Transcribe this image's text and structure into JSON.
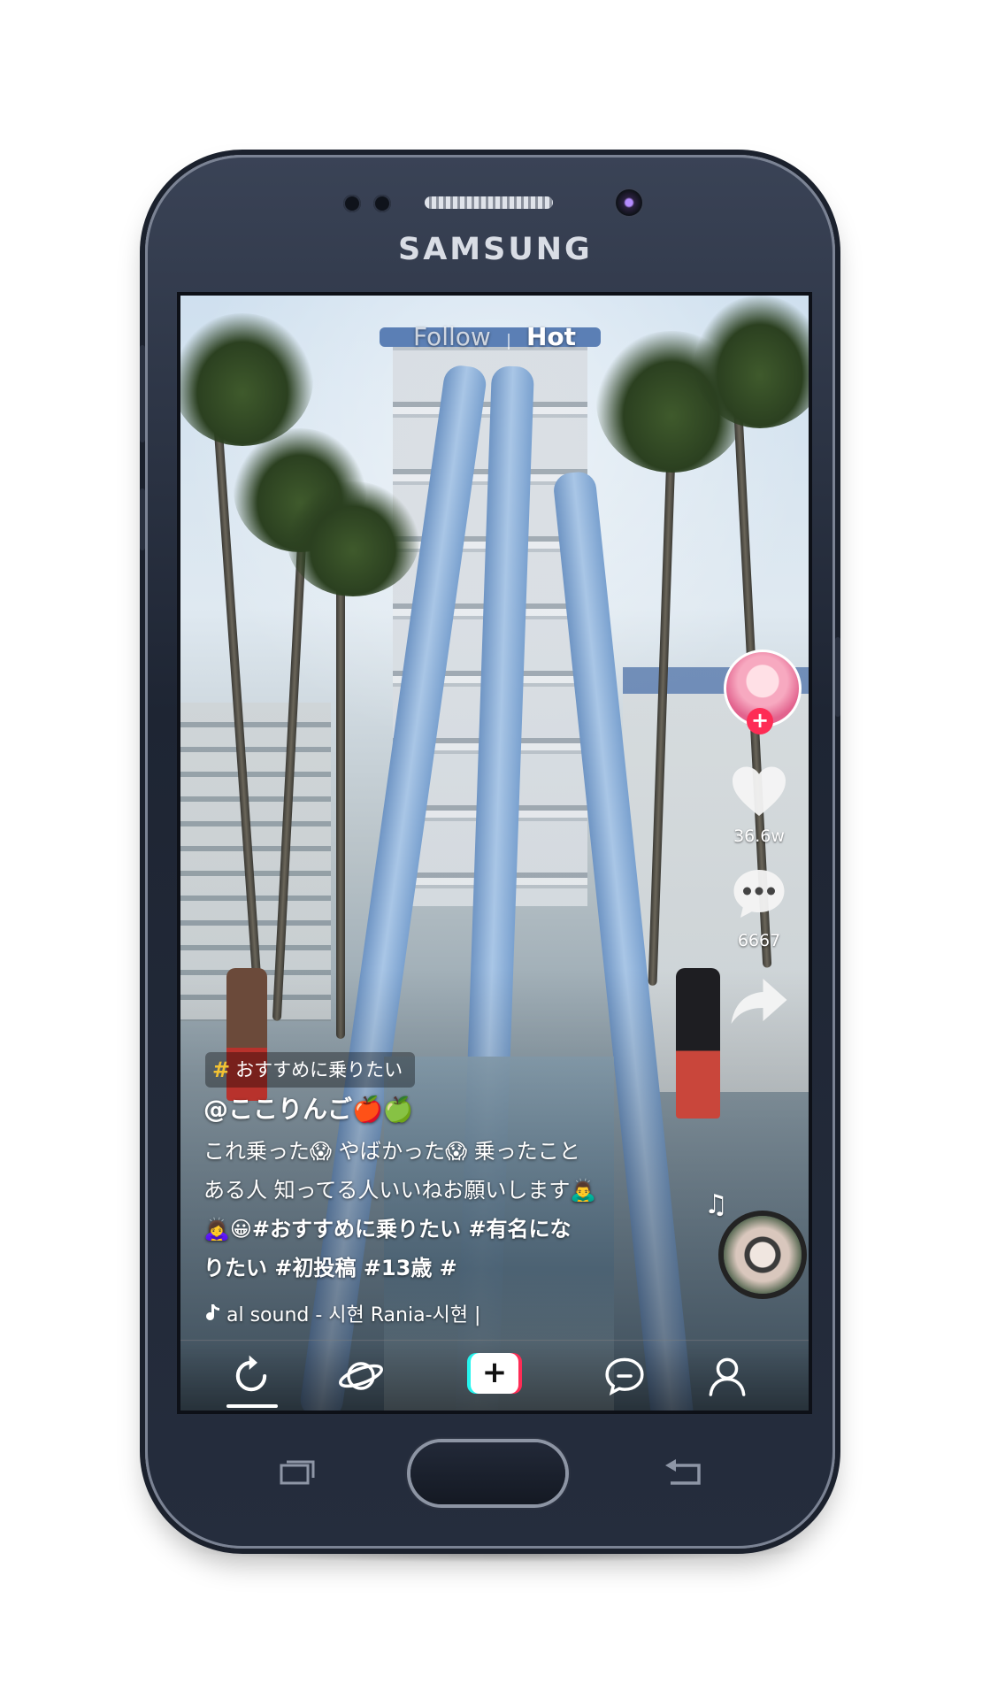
{
  "device": {
    "brand": "SAMSUNG"
  },
  "top_tabs": {
    "follow": "Follow",
    "hot": "Hot",
    "active": "hot"
  },
  "right_rail": {
    "like_count": "36.6w",
    "comment_count": "6667"
  },
  "post": {
    "hashtag_pill": "おすすめに乗りたい",
    "username": "@ここりんご🍎🍏",
    "caption_line1": "これ乗った😱 やばかった😱 乗ったこと",
    "caption_line2": "ある人 知ってる人いいねお願いします🙇‍♂️",
    "caption_line3_prefix": "🙇‍♀️😀",
    "caption_line3_tags": "#おすすめに乗りたい #有名にな",
    "caption_line4": "りたい #初投稿 #13歳 #",
    "sound": "al sound - 시현 Rania-시현 |"
  },
  "icons": {
    "hashtag": "hashtag-icon",
    "music_note": "music-note-icon",
    "like": "heart-icon",
    "comment": "comment-icon",
    "share": "share-icon",
    "home": "refresh-home-icon",
    "discover": "planet-icon",
    "create": "plus-icon",
    "inbox": "message-icon",
    "profile": "person-icon"
  },
  "colors": {
    "accent_red": "#fe2c55",
    "accent_cyan": "#25f4ee",
    "hashtag_gold": "#f3c233",
    "phone_body": "#1e2533"
  }
}
